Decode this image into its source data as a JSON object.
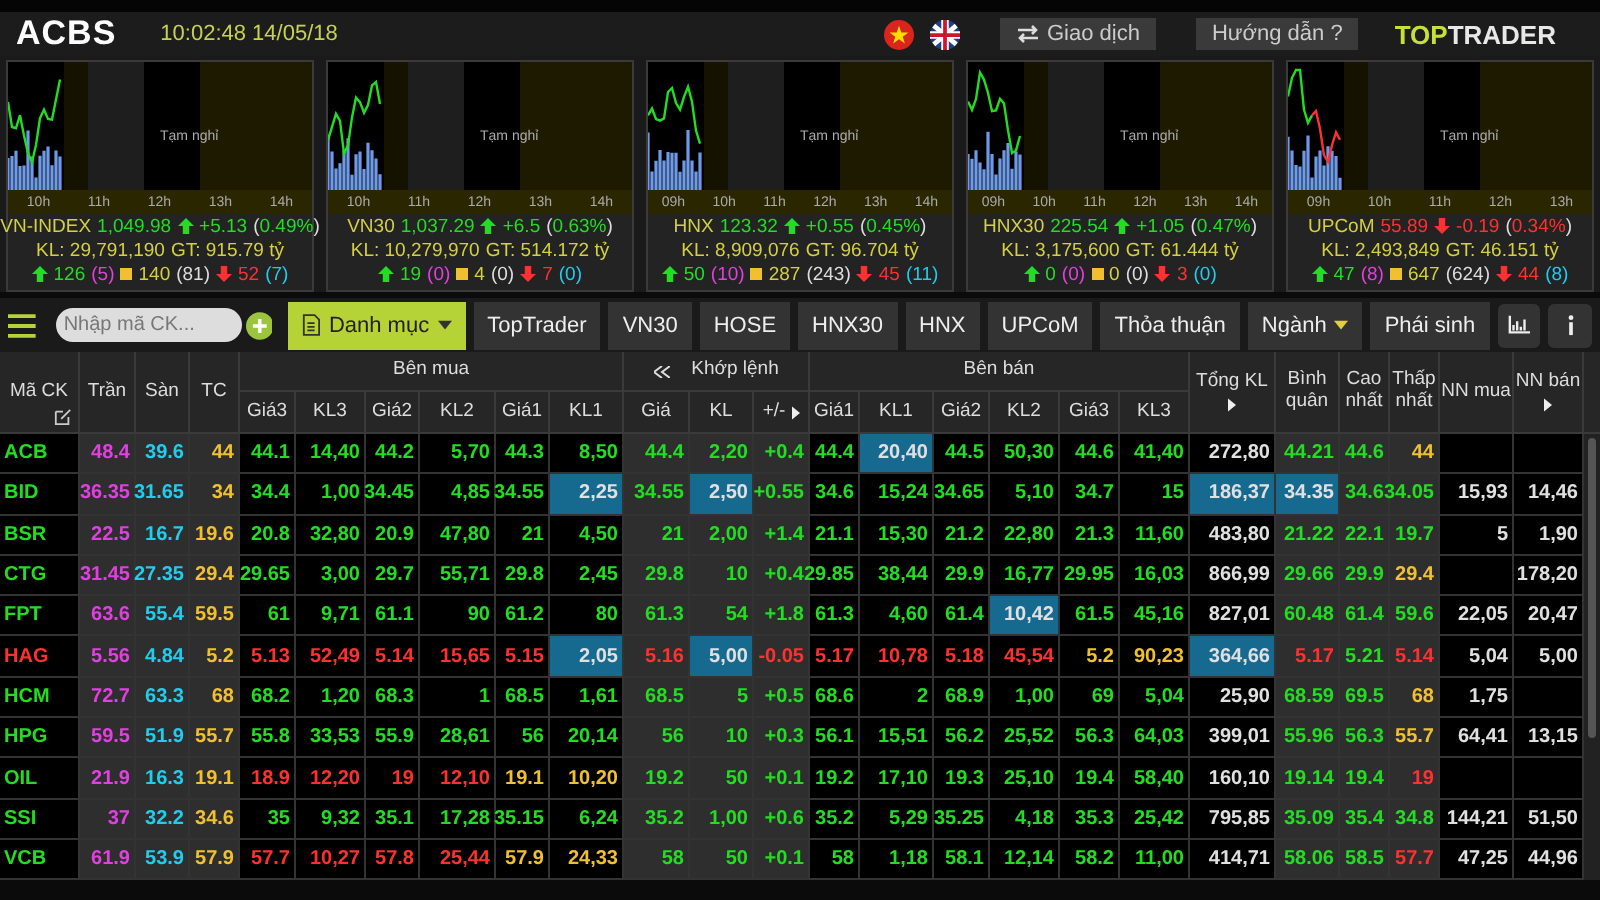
{
  "topbar": {
    "logo": "ACBS",
    "clock": "10:02:48 14/05/18",
    "buttons": [
      "Giao dịch",
      "Hướng dẫn ?"
    ],
    "brand": [
      "TOP",
      "TRADER"
    ]
  },
  "indices": [
    {
      "name": "VN-INDEX",
      "value": "1,049.98",
      "kind": "up",
      "change": "+5.13",
      "percent": "(0.49%)",
      "volume": "KL: 29,791,190",
      "turnover": "GT: 915.79 tỷ",
      "advances": "126",
      "ceiling": "(5)",
      "unchanged": "140",
      "unchanged_extra": "(81)",
      "declines": "52",
      "floor": "(7)",
      "pause": "Tạm nghỉ",
      "ticks": [
        "10h",
        "11h",
        "12h",
        "13h",
        "14h"
      ]
    },
    {
      "name": "VN30",
      "value": "1,037.29",
      "kind": "up",
      "change": "+6.5",
      "percent": "(0.63%)",
      "volume": "KL: 10,279,970",
      "turnover": "GT: 514.172 tỷ",
      "advances": "19",
      "ceiling": "(0)",
      "unchanged": "4",
      "unchanged_extra": "(0)",
      "declines": "7",
      "floor": "(0)",
      "pause": "Tạm nghỉ",
      "ticks": [
        "10h",
        "11h",
        "12h",
        "13h",
        "14h"
      ]
    },
    {
      "name": "HNX",
      "value": "123.32",
      "kind": "up",
      "change": "+0.55",
      "percent": "(0.45%)",
      "volume": "KL: 8,909,076",
      "turnover": "GT: 96.704 tỷ",
      "advances": "50",
      "ceiling": "(10)",
      "unchanged": "287",
      "unchanged_extra": "(243)",
      "declines": "45",
      "floor": "(11)",
      "pause": "Tạm nghỉ",
      "ticks": [
        "09h",
        "10h",
        "11h",
        "12h",
        "13h",
        "14h"
      ]
    },
    {
      "name": "HNX30",
      "value": "225.54",
      "kind": "up",
      "change": "+1.05",
      "percent": "(0.47%)",
      "volume": "KL: 3,175,600",
      "turnover": "GT: 61.444 tỷ",
      "advances": "0",
      "ceiling": "(0)",
      "unchanged": "0",
      "unchanged_extra": "(0)",
      "declines": "3",
      "floor": "(0)",
      "pause": "Tạm nghỉ",
      "ticks": [
        "09h",
        "10h",
        "11h",
        "12h",
        "13h",
        "14h"
      ]
    },
    {
      "name": "UPCoM",
      "value": "55.89",
      "kind": "down",
      "change": "-0.19",
      "percent": "(0.34%)",
      "volume": "KL: 2,493,849",
      "turnover": "GT: 46.151 tỷ",
      "advances": "47",
      "ceiling": "(8)",
      "unchanged": "647",
      "unchanged_extra": "(624)",
      "declines": "44",
      "floor": "(8)",
      "pause": "Tạm nghỉ",
      "ticks": [
        "09h",
        "10h",
        "11h",
        "12h",
        "13h"
      ]
    }
  ],
  "toolbar": {
    "search": {
      "placeholder": "Nhập mã CK..."
    },
    "tabs": [
      {
        "label": "Danh mục",
        "kind": "menu",
        "selected": true
      },
      {
        "label": "TopTrader",
        "kind": "plain",
        "selected": false
      },
      {
        "label": "VN30",
        "kind": "plain",
        "selected": false
      },
      {
        "label": "HOSE",
        "kind": "plain",
        "selected": false
      },
      {
        "label": "HNX30",
        "kind": "plain",
        "selected": false
      },
      {
        "label": "HNX",
        "kind": "plain",
        "selected": false
      },
      {
        "label": "UPCoM",
        "kind": "plain",
        "selected": false
      },
      {
        "label": "Thỏa thuận",
        "kind": "plain",
        "selected": false
      },
      {
        "label": "Ngành",
        "kind": "dropdown",
        "selected": false
      },
      {
        "label": "Phái sinh",
        "kind": "plain",
        "selected": false
      }
    ]
  },
  "table": {
    "columns": [
      {
        "kind": "single",
        "label": "Mã CK"
      },
      {
        "kind": "single",
        "label": "Trần"
      },
      {
        "kind": "single",
        "label": "Sàn"
      },
      {
        "kind": "single",
        "label": "TC"
      },
      {
        "kind": "sub",
        "group": "Bên mua",
        "label": "Giá3"
      },
      {
        "kind": "sub",
        "label": "KL3"
      },
      {
        "kind": "sub",
        "label": "Giá2"
      },
      {
        "kind": "sub",
        "label": "KL2"
      },
      {
        "kind": "sub",
        "label": "Giá1"
      },
      {
        "kind": "sub",
        "label": "KL1"
      },
      {
        "kind": "sub",
        "group": "Khớp lệnh",
        "label": "Giá"
      },
      {
        "kind": "sub",
        "label": "KL"
      },
      {
        "kind": "sub",
        "label": "+/-"
      },
      {
        "kind": "sub",
        "group": "Bên bán",
        "label": "Giá1"
      },
      {
        "kind": "sub",
        "label": "KL1"
      },
      {
        "kind": "sub",
        "label": "Giá2"
      },
      {
        "kind": "sub",
        "label": "KL2"
      },
      {
        "kind": "sub",
        "label": "Giá3"
      },
      {
        "kind": "sub",
        "label": "KL3"
      },
      {
        "kind": "single",
        "label": "Tổng KL"
      },
      {
        "kind": "single",
        "label": "Bình quân"
      },
      {
        "kind": "single",
        "label": "Cao nhất"
      },
      {
        "kind": "single",
        "label": "Thấp nhất"
      },
      {
        "kind": "single",
        "label": "NN mua"
      },
      {
        "kind": "single",
        "label": "NN bán"
      }
    ],
    "rows": [
      {
        "cells": [
          {
            "v": "ACB",
            "color": "#22dd22",
            "flash": false
          },
          {
            "v": "48.4",
            "color": "#e040e0",
            "flash": false
          },
          {
            "v": "39.6",
            "color": "#22ccee",
            "flash": false
          },
          {
            "v": "44",
            "color": "#f0c030",
            "flash": false
          },
          {
            "v": "44.1",
            "color": "#22dd22",
            "flash": false
          },
          {
            "v": "14,40",
            "color": "#22dd22",
            "flash": false
          },
          {
            "v": "44.2",
            "color": "#22dd22",
            "flash": false
          },
          {
            "v": "5,70",
            "color": "#22dd22",
            "flash": false
          },
          {
            "v": "44.3",
            "color": "#22dd22",
            "flash": false
          },
          {
            "v": "8,50",
            "color": "#22dd22",
            "flash": false
          },
          {
            "v": "44.4",
            "color": "#22dd22",
            "flash": false
          },
          {
            "v": "2,20",
            "color": "#22dd22",
            "flash": false
          },
          {
            "v": "+0.4",
            "color": "#22dd22",
            "flash": false
          },
          {
            "v": "44.4",
            "color": "#22dd22",
            "flash": false
          },
          {
            "v": "20,40",
            "color": "#e0e0e0",
            "flash": true
          },
          {
            "v": "44.5",
            "color": "#22dd22",
            "flash": false
          },
          {
            "v": "50,30",
            "color": "#22dd22",
            "flash": false
          },
          {
            "v": "44.6",
            "color": "#22dd22",
            "flash": false
          },
          {
            "v": "41,40",
            "color": "#22dd22",
            "flash": false
          },
          {
            "v": "272,80",
            "color": "#e0e0e0",
            "flash": false
          },
          {
            "v": "44.21",
            "color": "#22dd22",
            "flash": false
          },
          {
            "v": "44.6",
            "color": "#22dd22",
            "flash": false
          },
          {
            "v": "44",
            "color": "#f0c030",
            "flash": false
          },
          null,
          null
        ]
      },
      {
        "cells": [
          {
            "v": "BID",
            "color": "#22dd22",
            "flash": false
          },
          {
            "v": "36.35",
            "color": "#e040e0",
            "flash": false
          },
          {
            "v": "31.65",
            "color": "#22ccee",
            "flash": false
          },
          {
            "v": "34",
            "color": "#f0c030",
            "flash": false
          },
          {
            "v": "34.4",
            "color": "#22dd22",
            "flash": false
          },
          {
            "v": "1,00",
            "color": "#22dd22",
            "flash": false
          },
          {
            "v": "34.45",
            "color": "#22dd22",
            "flash": false
          },
          {
            "v": "4,85",
            "color": "#22dd22",
            "flash": false
          },
          {
            "v": "34.55",
            "color": "#22dd22",
            "flash": false
          },
          {
            "v": "2,25",
            "color": "#e0e0e0",
            "flash": true
          },
          {
            "v": "34.55",
            "color": "#22dd22",
            "flash": false
          },
          {
            "v": "2,50",
            "color": "#e0e0e0",
            "flash": true
          },
          {
            "v": "+0.55",
            "color": "#22dd22",
            "flash": false
          },
          {
            "v": "34.6",
            "color": "#22dd22",
            "flash": false
          },
          {
            "v": "15,24",
            "color": "#22dd22",
            "flash": false
          },
          {
            "v": "34.65",
            "color": "#22dd22",
            "flash": false
          },
          {
            "v": "5,10",
            "color": "#22dd22",
            "flash": false
          },
          {
            "v": "34.7",
            "color": "#22dd22",
            "flash": false
          },
          {
            "v": "15",
            "color": "#22dd22",
            "flash": false
          },
          {
            "v": "186,37",
            "color": "#e0e0e0",
            "flash": true
          },
          {
            "v": "34.35",
            "color": "#e0e0e0",
            "flash": true
          },
          {
            "v": "34.6",
            "color": "#22dd22",
            "flash": false
          },
          {
            "v": "34.05",
            "color": "#22dd22",
            "flash": false
          },
          {
            "v": "15,93",
            "color": "#e0e0e0",
            "flash": false
          },
          {
            "v": "14,46",
            "color": "#e0e0e0",
            "flash": false
          }
        ]
      },
      {
        "cells": [
          {
            "v": "BSR",
            "color": "#22dd22",
            "flash": false
          },
          {
            "v": "22.5",
            "color": "#e040e0",
            "flash": false
          },
          {
            "v": "16.7",
            "color": "#22ccee",
            "flash": false
          },
          {
            "v": "19.6",
            "color": "#f0c030",
            "flash": false
          },
          {
            "v": "20.8",
            "color": "#22dd22",
            "flash": false
          },
          {
            "v": "32,80",
            "color": "#22dd22",
            "flash": false
          },
          {
            "v": "20.9",
            "color": "#22dd22",
            "flash": false
          },
          {
            "v": "47,80",
            "color": "#22dd22",
            "flash": false
          },
          {
            "v": "21",
            "color": "#22dd22",
            "flash": false
          },
          {
            "v": "4,50",
            "color": "#22dd22",
            "flash": false
          },
          {
            "v": "21",
            "color": "#22dd22",
            "flash": false
          },
          {
            "v": "2,00",
            "color": "#22dd22",
            "flash": false
          },
          {
            "v": "+1.4",
            "color": "#22dd22",
            "flash": false
          },
          {
            "v": "21.1",
            "color": "#22dd22",
            "flash": false
          },
          {
            "v": "15,30",
            "color": "#22dd22",
            "flash": false
          },
          {
            "v": "21.2",
            "color": "#22dd22",
            "flash": false
          },
          {
            "v": "22,80",
            "color": "#22dd22",
            "flash": false
          },
          {
            "v": "21.3",
            "color": "#22dd22",
            "flash": false
          },
          {
            "v": "11,60",
            "color": "#22dd22",
            "flash": false
          },
          {
            "v": "483,80",
            "color": "#e0e0e0",
            "flash": false
          },
          {
            "v": "21.22",
            "color": "#22dd22",
            "flash": false
          },
          {
            "v": "22.1",
            "color": "#22dd22",
            "flash": false
          },
          {
            "v": "19.7",
            "color": "#22dd22",
            "flash": false
          },
          {
            "v": "5",
            "color": "#e0e0e0",
            "flash": false
          },
          {
            "v": "1,90",
            "color": "#e0e0e0",
            "flash": false
          }
        ]
      },
      {
        "cells": [
          {
            "v": "CTG",
            "color": "#22dd22",
            "flash": false
          },
          {
            "v": "31.45",
            "color": "#e040e0",
            "flash": false
          },
          {
            "v": "27.35",
            "color": "#22ccee",
            "flash": false
          },
          {
            "v": "29.4",
            "color": "#f0c030",
            "flash": false
          },
          {
            "v": "29.65",
            "color": "#22dd22",
            "flash": false
          },
          {
            "v": "3,00",
            "color": "#22dd22",
            "flash": false
          },
          {
            "v": "29.7",
            "color": "#22dd22",
            "flash": false
          },
          {
            "v": "55,71",
            "color": "#22dd22",
            "flash": false
          },
          {
            "v": "29.8",
            "color": "#22dd22",
            "flash": false
          },
          {
            "v": "2,45",
            "color": "#22dd22",
            "flash": false
          },
          {
            "v": "29.8",
            "color": "#22dd22",
            "flash": false
          },
          {
            "v": "10",
            "color": "#22dd22",
            "flash": false
          },
          {
            "v": "+0.4",
            "color": "#22dd22",
            "flash": false
          },
          {
            "v": "29.85",
            "color": "#22dd22",
            "flash": false
          },
          {
            "v": "38,44",
            "color": "#22dd22",
            "flash": false
          },
          {
            "v": "29.9",
            "color": "#22dd22",
            "flash": false
          },
          {
            "v": "16,77",
            "color": "#22dd22",
            "flash": false
          },
          {
            "v": "29.95",
            "color": "#22dd22",
            "flash": false
          },
          {
            "v": "16,03",
            "color": "#22dd22",
            "flash": false
          },
          {
            "v": "866,99",
            "color": "#e0e0e0",
            "flash": false
          },
          {
            "v": "29.66",
            "color": "#22dd22",
            "flash": false
          },
          {
            "v": "29.9",
            "color": "#22dd22",
            "flash": false
          },
          {
            "v": "29.4",
            "color": "#f0c030",
            "flash": false
          },
          null,
          {
            "v": "178,20",
            "color": "#e0e0e0",
            "flash": false
          }
        ]
      },
      {
        "cells": [
          {
            "v": "FPT",
            "color": "#22dd22",
            "flash": false
          },
          {
            "v": "63.6",
            "color": "#e040e0",
            "flash": false
          },
          {
            "v": "55.4",
            "color": "#22ccee",
            "flash": false
          },
          {
            "v": "59.5",
            "color": "#f0c030",
            "flash": false
          },
          {
            "v": "61",
            "color": "#22dd22",
            "flash": false
          },
          {
            "v": "9,71",
            "color": "#22dd22",
            "flash": false
          },
          {
            "v": "61.1",
            "color": "#22dd22",
            "flash": false
          },
          {
            "v": "90",
            "color": "#22dd22",
            "flash": false
          },
          {
            "v": "61.2",
            "color": "#22dd22",
            "flash": false
          },
          {
            "v": "80",
            "color": "#22dd22",
            "flash": false
          },
          {
            "v": "61.3",
            "color": "#22dd22",
            "flash": false
          },
          {
            "v": "54",
            "color": "#22dd22",
            "flash": false
          },
          {
            "v": "+1.8",
            "color": "#22dd22",
            "flash": false
          },
          {
            "v": "61.3",
            "color": "#22dd22",
            "flash": false
          },
          {
            "v": "4,60",
            "color": "#22dd22",
            "flash": false
          },
          {
            "v": "61.4",
            "color": "#22dd22",
            "flash": false
          },
          {
            "v": "10,42",
            "color": "#e0e0e0",
            "flash": true
          },
          {
            "v": "61.5",
            "color": "#22dd22",
            "flash": false
          },
          {
            "v": "45,16",
            "color": "#22dd22",
            "flash": false
          },
          {
            "v": "827,01",
            "color": "#e0e0e0",
            "flash": false
          },
          {
            "v": "60.48",
            "color": "#22dd22",
            "flash": false
          },
          {
            "v": "61.4",
            "color": "#22dd22",
            "flash": false
          },
          {
            "v": "59.6",
            "color": "#22dd22",
            "flash": false
          },
          {
            "v": "22,05",
            "color": "#e0e0e0",
            "flash": false
          },
          {
            "v": "20,47",
            "color": "#e0e0e0",
            "flash": false
          }
        ]
      },
      {
        "cells": [
          {
            "v": "HAG",
            "color": "#ff3030",
            "flash": false
          },
          {
            "v": "5.56",
            "color": "#e040e0",
            "flash": false
          },
          {
            "v": "4.84",
            "color": "#22ccee",
            "flash": false
          },
          {
            "v": "5.2",
            "color": "#f0c030",
            "flash": false
          },
          {
            "v": "5.13",
            "color": "#ff3030",
            "flash": false
          },
          {
            "v": "52,49",
            "color": "#ff3030",
            "flash": false
          },
          {
            "v": "5.14",
            "color": "#ff3030",
            "flash": false
          },
          {
            "v": "15,65",
            "color": "#ff3030",
            "flash": false
          },
          {
            "v": "5.15",
            "color": "#ff3030",
            "flash": false
          },
          {
            "v": "2,05",
            "color": "#e0e0e0",
            "flash": true
          },
          {
            "v": "5.16",
            "color": "#ff3030",
            "flash": false
          },
          {
            "v": "5,00",
            "color": "#e0e0e0",
            "flash": true
          },
          {
            "v": "-0.05",
            "color": "#ff3030",
            "flash": false
          },
          {
            "v": "5.17",
            "color": "#ff3030",
            "flash": false
          },
          {
            "v": "10,78",
            "color": "#ff3030",
            "flash": false
          },
          {
            "v": "5.18",
            "color": "#ff3030",
            "flash": false
          },
          {
            "v": "45,54",
            "color": "#ff3030",
            "flash": false
          },
          {
            "v": "5.2",
            "color": "#f0c030",
            "flash": false
          },
          {
            "v": "90,23",
            "color": "#f0c030",
            "flash": false
          },
          {
            "v": "364,66",
            "color": "#e0e0e0",
            "flash": true
          },
          {
            "v": "5.17",
            "color": "#ff3030",
            "flash": false
          },
          {
            "v": "5.21",
            "color": "#22dd22",
            "flash": false
          },
          {
            "v": "5.14",
            "color": "#ff3030",
            "flash": false
          },
          {
            "v": "5,04",
            "color": "#e0e0e0",
            "flash": false
          },
          {
            "v": "5,00",
            "color": "#e0e0e0",
            "flash": false
          }
        ]
      },
      {
        "cells": [
          {
            "v": "HCM",
            "color": "#22dd22",
            "flash": false
          },
          {
            "v": "72.7",
            "color": "#e040e0",
            "flash": false
          },
          {
            "v": "63.3",
            "color": "#22ccee",
            "flash": false
          },
          {
            "v": "68",
            "color": "#f0c030",
            "flash": false
          },
          {
            "v": "68.2",
            "color": "#22dd22",
            "flash": false
          },
          {
            "v": "1,20",
            "color": "#22dd22",
            "flash": false
          },
          {
            "v": "68.3",
            "color": "#22dd22",
            "flash": false
          },
          {
            "v": "1",
            "color": "#22dd22",
            "flash": false
          },
          {
            "v": "68.5",
            "color": "#22dd22",
            "flash": false
          },
          {
            "v": "1,61",
            "color": "#22dd22",
            "flash": false
          },
          {
            "v": "68.5",
            "color": "#22dd22",
            "flash": false
          },
          {
            "v": "5",
            "color": "#22dd22",
            "flash": false
          },
          {
            "v": "+0.5",
            "color": "#22dd22",
            "flash": false
          },
          {
            "v": "68.6",
            "color": "#22dd22",
            "flash": false
          },
          {
            "v": "2",
            "color": "#22dd22",
            "flash": false
          },
          {
            "v": "68.9",
            "color": "#22dd22",
            "flash": false
          },
          {
            "v": "1,00",
            "color": "#22dd22",
            "flash": false
          },
          {
            "v": "69",
            "color": "#22dd22",
            "flash": false
          },
          {
            "v": "5,04",
            "color": "#22dd22",
            "flash": false
          },
          {
            "v": "25,90",
            "color": "#e0e0e0",
            "flash": false
          },
          {
            "v": "68.59",
            "color": "#22dd22",
            "flash": false
          },
          {
            "v": "69.5",
            "color": "#22dd22",
            "flash": false
          },
          {
            "v": "68",
            "color": "#f0c030",
            "flash": false
          },
          {
            "v": "1,75",
            "color": "#e0e0e0",
            "flash": false
          },
          null
        ]
      },
      {
        "cells": [
          {
            "v": "HPG",
            "color": "#22dd22",
            "flash": false
          },
          {
            "v": "59.5",
            "color": "#e040e0",
            "flash": false
          },
          {
            "v": "51.9",
            "color": "#22ccee",
            "flash": false
          },
          {
            "v": "55.7",
            "color": "#f0c030",
            "flash": false
          },
          {
            "v": "55.8",
            "color": "#22dd22",
            "flash": false
          },
          {
            "v": "33,53",
            "color": "#22dd22",
            "flash": false
          },
          {
            "v": "55.9",
            "color": "#22dd22",
            "flash": false
          },
          {
            "v": "28,61",
            "color": "#22dd22",
            "flash": false
          },
          {
            "v": "56",
            "color": "#22dd22",
            "flash": false
          },
          {
            "v": "20,14",
            "color": "#22dd22",
            "flash": false
          },
          {
            "v": "56",
            "color": "#22dd22",
            "flash": false
          },
          {
            "v": "10",
            "color": "#22dd22",
            "flash": false
          },
          {
            "v": "+0.3",
            "color": "#22dd22",
            "flash": false
          },
          {
            "v": "56.1",
            "color": "#22dd22",
            "flash": false
          },
          {
            "v": "15,51",
            "color": "#22dd22",
            "flash": false
          },
          {
            "v": "56.2",
            "color": "#22dd22",
            "flash": false
          },
          {
            "v": "25,52",
            "color": "#22dd22",
            "flash": false
          },
          {
            "v": "56.3",
            "color": "#22dd22",
            "flash": false
          },
          {
            "v": "64,03",
            "color": "#22dd22",
            "flash": false
          },
          {
            "v": "399,01",
            "color": "#e0e0e0",
            "flash": false
          },
          {
            "v": "55.96",
            "color": "#22dd22",
            "flash": false
          },
          {
            "v": "56.3",
            "color": "#22dd22",
            "flash": false
          },
          {
            "v": "55.7",
            "color": "#f0c030",
            "flash": false
          },
          {
            "v": "64,41",
            "color": "#e0e0e0",
            "flash": false
          },
          {
            "v": "13,15",
            "color": "#e0e0e0",
            "flash": false
          }
        ]
      },
      {
        "cells": [
          {
            "v": "OIL",
            "color": "#22dd22",
            "flash": false
          },
          {
            "v": "21.9",
            "color": "#e040e0",
            "flash": false
          },
          {
            "v": "16.3",
            "color": "#22ccee",
            "flash": false
          },
          {
            "v": "19.1",
            "color": "#f0c030",
            "flash": false
          },
          {
            "v": "18.9",
            "color": "#ff3030",
            "flash": false
          },
          {
            "v": "12,20",
            "color": "#ff3030",
            "flash": false
          },
          {
            "v": "19",
            "color": "#ff3030",
            "flash": false
          },
          {
            "v": "12,10",
            "color": "#ff3030",
            "flash": false
          },
          {
            "v": "19.1",
            "color": "#f0c030",
            "flash": false
          },
          {
            "v": "10,20",
            "color": "#f0c030",
            "flash": false
          },
          {
            "v": "19.2",
            "color": "#22dd22",
            "flash": false
          },
          {
            "v": "50",
            "color": "#22dd22",
            "flash": false
          },
          {
            "v": "+0.1",
            "color": "#22dd22",
            "flash": false
          },
          {
            "v": "19.2",
            "color": "#22dd22",
            "flash": false
          },
          {
            "v": "17,10",
            "color": "#22dd22",
            "flash": false
          },
          {
            "v": "19.3",
            "color": "#22dd22",
            "flash": false
          },
          {
            "v": "25,10",
            "color": "#22dd22",
            "flash": false
          },
          {
            "v": "19.4",
            "color": "#22dd22",
            "flash": false
          },
          {
            "v": "58,40",
            "color": "#22dd22",
            "flash": false
          },
          {
            "v": "160,10",
            "color": "#e0e0e0",
            "flash": false
          },
          {
            "v": "19.14",
            "color": "#22dd22",
            "flash": false
          },
          {
            "v": "19.4",
            "color": "#22dd22",
            "flash": false
          },
          {
            "v": "19",
            "color": "#ff3030",
            "flash": false
          },
          null,
          null
        ]
      },
      {
        "cells": [
          {
            "v": "SSI",
            "color": "#22dd22",
            "flash": false
          },
          {
            "v": "37",
            "color": "#e040e0",
            "flash": false
          },
          {
            "v": "32.2",
            "color": "#22ccee",
            "flash": false
          },
          {
            "v": "34.6",
            "color": "#f0c030",
            "flash": false
          },
          {
            "v": "35",
            "color": "#22dd22",
            "flash": false
          },
          {
            "v": "9,32",
            "color": "#22dd22",
            "flash": false
          },
          {
            "v": "35.1",
            "color": "#22dd22",
            "flash": false
          },
          {
            "v": "17,28",
            "color": "#22dd22",
            "flash": false
          },
          {
            "v": "35.15",
            "color": "#22dd22",
            "flash": false
          },
          {
            "v": "6,24",
            "color": "#22dd22",
            "flash": false
          },
          {
            "v": "35.2",
            "color": "#22dd22",
            "flash": false
          },
          {
            "v": "1,00",
            "color": "#22dd22",
            "flash": false
          },
          {
            "v": "+0.6",
            "color": "#22dd22",
            "flash": false
          },
          {
            "v": "35.2",
            "color": "#22dd22",
            "flash": false
          },
          {
            "v": "5,29",
            "color": "#22dd22",
            "flash": false
          },
          {
            "v": "35.25",
            "color": "#22dd22",
            "flash": false
          },
          {
            "v": "4,18",
            "color": "#22dd22",
            "flash": false
          },
          {
            "v": "35.3",
            "color": "#22dd22",
            "flash": false
          },
          {
            "v": "25,42",
            "color": "#22dd22",
            "flash": false
          },
          {
            "v": "795,85",
            "color": "#e0e0e0",
            "flash": false
          },
          {
            "v": "35.09",
            "color": "#22dd22",
            "flash": false
          },
          {
            "v": "35.4",
            "color": "#22dd22",
            "flash": false
          },
          {
            "v": "34.8",
            "color": "#22dd22",
            "flash": false
          },
          {
            "v": "144,21",
            "color": "#e0e0e0",
            "flash": false
          },
          {
            "v": "51,50",
            "color": "#e0e0e0",
            "flash": false
          }
        ]
      },
      {
        "cells": [
          {
            "v": "VCB",
            "color": "#22dd22",
            "flash": false
          },
          {
            "v": "61.9",
            "color": "#e040e0",
            "flash": false
          },
          {
            "v": "53.9",
            "color": "#22ccee",
            "flash": false
          },
          {
            "v": "57.9",
            "color": "#f0c030",
            "flash": false
          },
          {
            "v": "57.7",
            "color": "#ff3030",
            "flash": false
          },
          {
            "v": "10,27",
            "color": "#ff3030",
            "flash": false
          },
          {
            "v": "57.8",
            "color": "#ff3030",
            "flash": false
          },
          {
            "v": "25,44",
            "color": "#ff3030",
            "flash": false
          },
          {
            "v": "57.9",
            "color": "#f0c030",
            "flash": false
          },
          {
            "v": "24,33",
            "color": "#f0c030",
            "flash": false
          },
          {
            "v": "58",
            "color": "#22dd22",
            "flash": false
          },
          {
            "v": "50",
            "color": "#22dd22",
            "flash": false
          },
          {
            "v": "+0.1",
            "color": "#22dd22",
            "flash": false
          },
          {
            "v": "58",
            "color": "#22dd22",
            "flash": false
          },
          {
            "v": "1,18",
            "color": "#22dd22",
            "flash": false
          },
          {
            "v": "58.1",
            "color": "#22dd22",
            "flash": false
          },
          {
            "v": "12,14",
            "color": "#22dd22",
            "flash": false
          },
          {
            "v": "58.2",
            "color": "#22dd22",
            "flash": false
          },
          {
            "v": "11,00",
            "color": "#22dd22",
            "flash": false
          },
          {
            "v": "414,71",
            "color": "#e0e0e0",
            "flash": false
          },
          {
            "v": "58.06",
            "color": "#22dd22",
            "flash": false
          },
          {
            "v": "58.5",
            "color": "#22dd22",
            "flash": false
          },
          {
            "v": "57.7",
            "color": "#ff3030",
            "flash": false
          },
          {
            "v": "47,25",
            "color": "#e0e0e0",
            "flash": false
          },
          {
            "v": "44,96",
            "color": "#e0e0e0",
            "flash": false
          }
        ]
      }
    ]
  }
}
